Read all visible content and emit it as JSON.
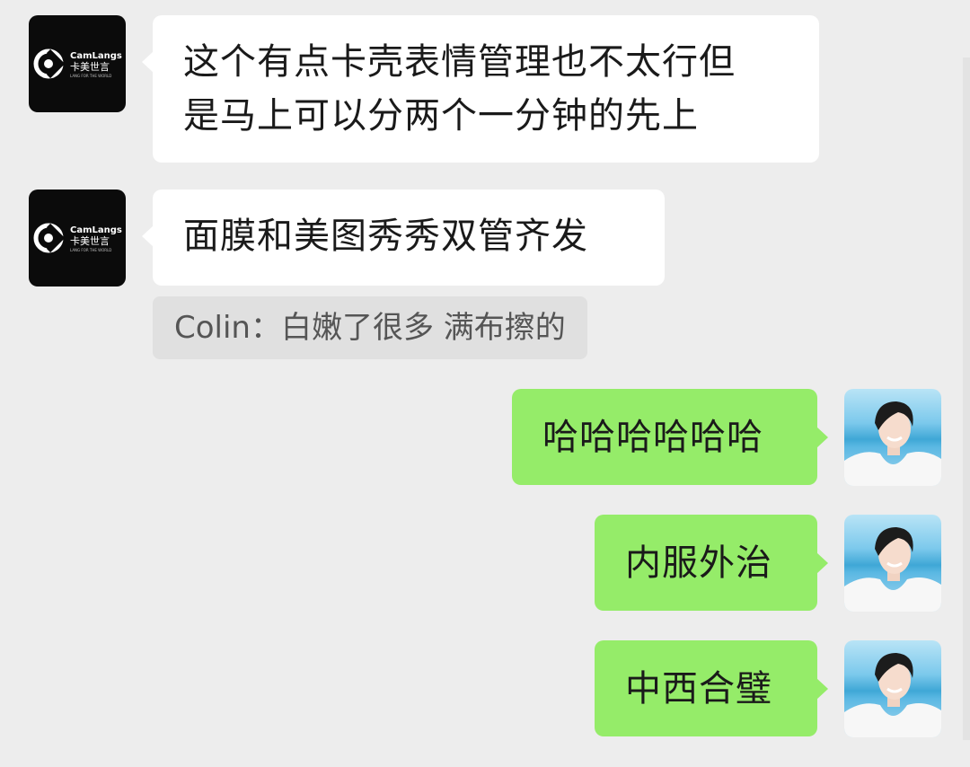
{
  "chat": {
    "messages": [
      {
        "side": "left",
        "sender_avatar": "camlangs-logo",
        "text": "这个有点卡壳表情管理也不太行但\n是马上可以分两个一分钟的先上"
      },
      {
        "side": "left",
        "sender_avatar": "camlangs-logo",
        "text": "面膜和美图秀秀双管齐发"
      },
      {
        "side": "right",
        "sender_avatar": "user-photo",
        "text": "哈哈哈哈哈哈"
      },
      {
        "side": "right",
        "sender_avatar": "user-photo",
        "text": "内服外治"
      },
      {
        "side": "right",
        "sender_avatar": "user-photo",
        "text": "中西合璧"
      }
    ],
    "quote": {
      "text": "Colin：白嫩了很多 满布擦的"
    }
  },
  "logo": {
    "brand": "CamLangs",
    "brand_cn": "卡美世言",
    "tagline": "LANG FOR THE WORLD"
  },
  "colors": {
    "background": "#ededed",
    "left_bubble": "#ffffff",
    "right_bubble": "#95ec69",
    "quote_bg": "#e0e0e0"
  }
}
